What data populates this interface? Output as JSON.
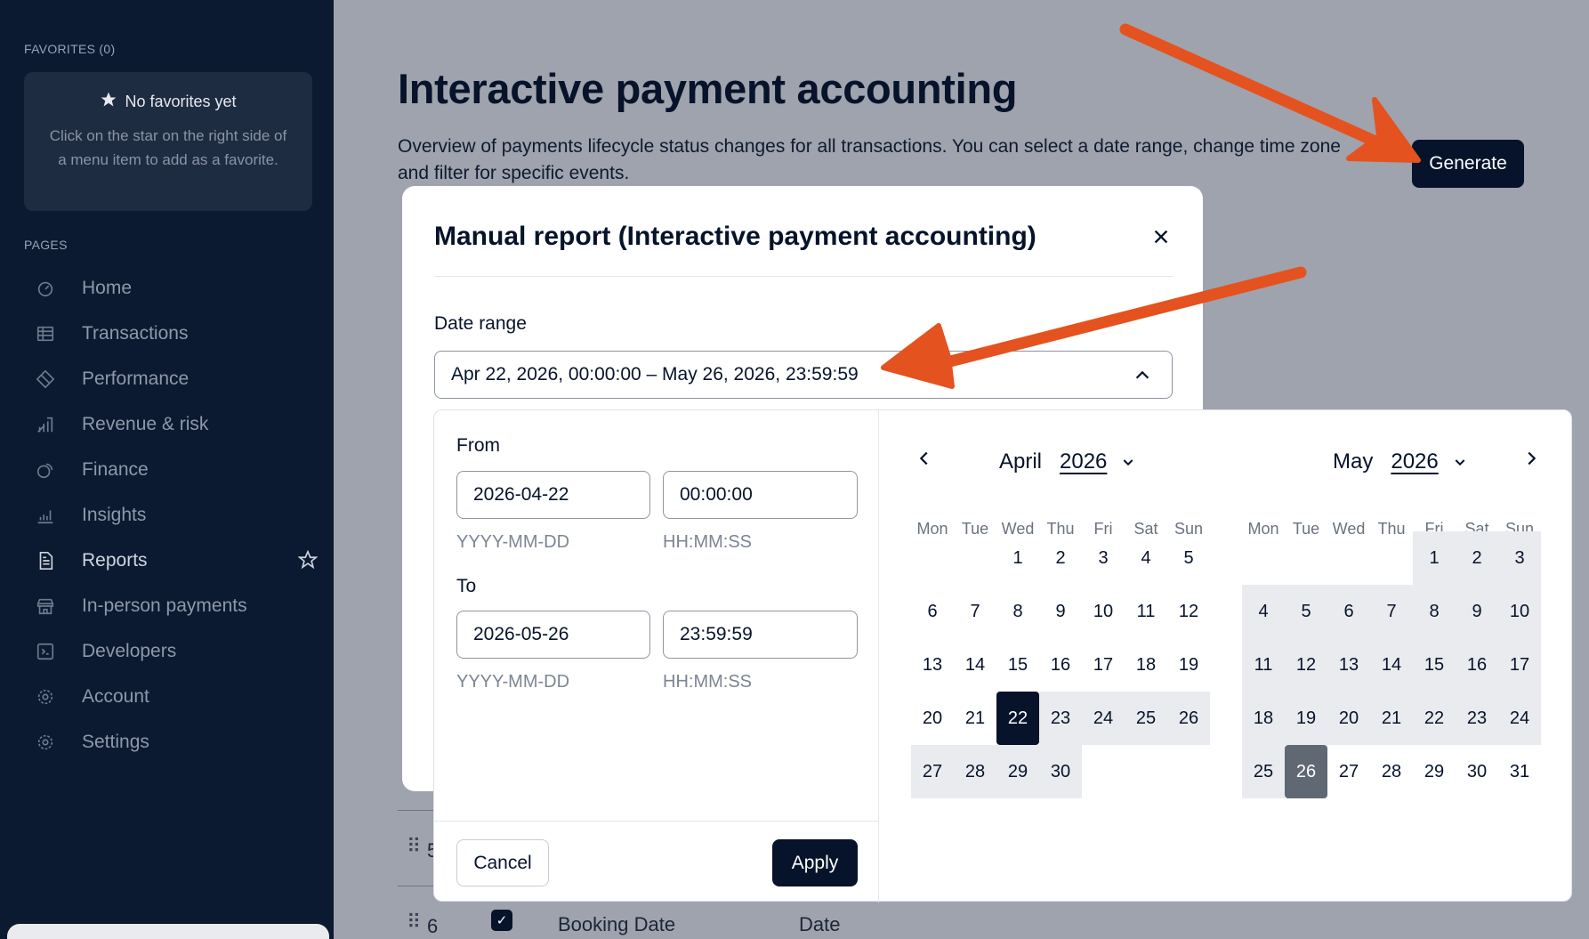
{
  "sidebar": {
    "favorites_label": "FAVORITES (0)",
    "no_favorites_title": "No favorites yet",
    "no_favorites_desc": "Click on the star on the right side of a menu item to add as a favorite.",
    "pages_label": "PAGES",
    "items": [
      {
        "label": "Home",
        "icon": "home-icon"
      },
      {
        "label": "Transactions",
        "icon": "table-icon"
      },
      {
        "label": "Performance",
        "icon": "diamond-icon"
      },
      {
        "label": "Revenue & risk",
        "icon": "chart-icon"
      },
      {
        "label": "Finance",
        "icon": "coins-icon"
      },
      {
        "label": "Insights",
        "icon": "bars-icon"
      },
      {
        "label": "Reports",
        "icon": "document-icon",
        "active": true
      },
      {
        "label": "In-person payments",
        "icon": "store-icon"
      },
      {
        "label": "Developers",
        "icon": "terminal-icon"
      },
      {
        "label": "Account",
        "icon": "gear-icon"
      },
      {
        "label": "Settings",
        "icon": "gear-icon"
      }
    ]
  },
  "page": {
    "title": "Interactive payment accounting",
    "description": "Overview of payments lifecycle status changes for all transactions. You can select a date range, change time zone and filter for specific events.",
    "generate_label": "Generate",
    "row5_num": "5",
    "row6_num": "6",
    "row6_name": "Booking Date",
    "row6_type": "Date"
  },
  "modal": {
    "title": "Manual report (Interactive payment accounting)",
    "date_range_label": "Date range",
    "date_range_value": "Apr 22, 2026, 00:00:00 – May 26, 2026, 23:59:59"
  },
  "picker": {
    "from_label": "From",
    "from_date": "2026-04-22",
    "from_time": "00:00:00",
    "to_label": "To",
    "to_date": "2026-05-26",
    "to_time": "23:59:59",
    "date_hint": "YYYY-MM-DD",
    "time_hint": "HH:MM:SS",
    "cancel_label": "Cancel",
    "apply_label": "Apply",
    "weekdays": [
      "Mon",
      "Tue",
      "Wed",
      "Thu",
      "Fri",
      "Sat",
      "Sun"
    ],
    "months": [
      {
        "month": "April",
        "year": "2026",
        "first_weekday": 2,
        "days": 30,
        "range_start": 22,
        "range_end": 30,
        "selected": 22
      },
      {
        "month": "May",
        "year": "2026",
        "first_weekday": 4,
        "days": 31,
        "range_start": 1,
        "range_end": 26,
        "end": 26
      }
    ]
  },
  "colors": {
    "sidebar_bg": "#0b1a31",
    "primary": "#06132b",
    "range_bg": "#e9ebee",
    "annotation_arrow": "#e4521f"
  }
}
